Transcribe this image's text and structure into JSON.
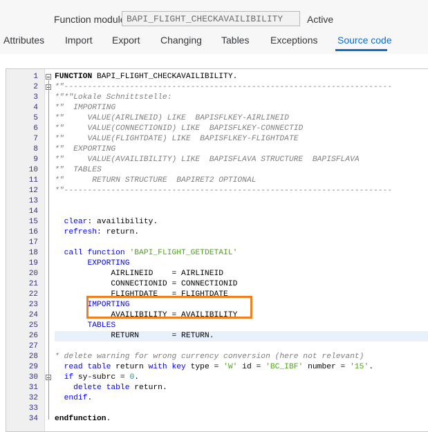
{
  "header": {
    "function_module_label": "Function module:",
    "function_module_value": "BAPI_FLIGHT_CHECKAVAILIBILITY",
    "status": "Active"
  },
  "tabs": [
    {
      "label": "Attributes",
      "active": false
    },
    {
      "label": "Import",
      "active": false
    },
    {
      "label": "Export",
      "active": false
    },
    {
      "label": "Changing",
      "active": false
    },
    {
      "label": "Tables",
      "active": false
    },
    {
      "label": "Exceptions",
      "active": false
    },
    {
      "label": "Source code",
      "active": true
    }
  ],
  "colors": {
    "accent": "#0a6ed1",
    "keyword": "#0000ff",
    "comment": "#7f7f7f",
    "string": "#4da619",
    "highlight_box": "#f07f22"
  },
  "editor": {
    "highlighted_line": 26,
    "boxed_lines": [
      23,
      24
    ],
    "lines": [
      {
        "n": "1",
        "fold": "open",
        "segs": [
          [
            "kwb",
            "FUNCTION"
          ],
          [
            "txt",
            " BAPI_FLIGHT_CHECKAVAILIBILITY."
          ]
        ]
      },
      {
        "n": "2",
        "fold": "open",
        "segs": [
          [
            "cm",
            "*\"----------------------------------------------------------------------"
          ]
        ]
      },
      {
        "n": "3",
        "fold": "",
        "segs": [
          [
            "cm",
            "*\"*\"Lokale Schnittstelle:"
          ]
        ]
      },
      {
        "n": "4",
        "fold": "",
        "segs": [
          [
            "cm",
            "*\"  IMPORTING"
          ]
        ]
      },
      {
        "n": "5",
        "fold": "",
        "segs": [
          [
            "cm",
            "*\"     VALUE(AIRLINEID) LIKE  BAPISFLKEY-AIRLINEID"
          ]
        ]
      },
      {
        "n": "6",
        "fold": "",
        "segs": [
          [
            "cm",
            "*\"     VALUE(CONNECTIONID) LIKE  BAPISFLKEY-CONNECTID"
          ]
        ]
      },
      {
        "n": "7",
        "fold": "",
        "segs": [
          [
            "cm",
            "*\"     VALUE(FLIGHTDATE) LIKE  BAPISFLKEY-FLIGHTDATE"
          ]
        ]
      },
      {
        "n": "8",
        "fold": "",
        "segs": [
          [
            "cm",
            "*\"  EXPORTING"
          ]
        ]
      },
      {
        "n": "9",
        "fold": "",
        "segs": [
          [
            "cm",
            "*\"     VALUE(AVAILIBILITY) LIKE  BAPISFLAVA STRUCTURE  BAPISFLAVA"
          ]
        ]
      },
      {
        "n": "10",
        "fold": "",
        "segs": [
          [
            "cm",
            "*\"  TABLES"
          ]
        ]
      },
      {
        "n": "11",
        "fold": "",
        "segs": [
          [
            "cm",
            "*\"      RETURN STRUCTURE  BAPIRET2 OPTIONAL"
          ]
        ]
      },
      {
        "n": "12",
        "fold": "end",
        "segs": [
          [
            "cm",
            "*\"----------------------------------------------------------------------"
          ]
        ]
      },
      {
        "n": "13",
        "fold": "",
        "segs": []
      },
      {
        "n": "14",
        "fold": "",
        "segs": []
      },
      {
        "n": "15",
        "fold": "",
        "segs": [
          [
            "txt",
            "  "
          ],
          [
            "kw",
            "clear"
          ],
          [
            "txt",
            ": availibility."
          ]
        ]
      },
      {
        "n": "16",
        "fold": "",
        "segs": [
          [
            "txt",
            "  "
          ],
          [
            "kw",
            "refresh"
          ],
          [
            "txt",
            ": return."
          ]
        ]
      },
      {
        "n": "17",
        "fold": "",
        "segs": []
      },
      {
        "n": "18",
        "fold": "",
        "segs": [
          [
            "txt",
            "  "
          ],
          [
            "kw",
            "call function"
          ],
          [
            "txt",
            " "
          ],
          [
            "str",
            "'BAPI_FLIGHT_GETDETAIL'"
          ]
        ]
      },
      {
        "n": "19",
        "fold": "",
        "segs": [
          [
            "txt",
            "       "
          ],
          [
            "kw",
            "EXPORTING"
          ]
        ]
      },
      {
        "n": "20",
        "fold": "",
        "segs": [
          [
            "txt",
            "            AIRLINEID    = AIRLINEID"
          ]
        ]
      },
      {
        "n": "21",
        "fold": "",
        "segs": [
          [
            "txt",
            "            CONNECTIONID = CONNECTIONID"
          ]
        ]
      },
      {
        "n": "22",
        "fold": "",
        "segs": [
          [
            "txt",
            "            FLIGHTDATE   = FLIGHTDATE"
          ]
        ]
      },
      {
        "n": "23",
        "fold": "",
        "segs": [
          [
            "txt",
            "       "
          ],
          [
            "kw",
            "IMPORTING"
          ]
        ]
      },
      {
        "n": "24",
        "fold": "",
        "segs": [
          [
            "txt",
            "            AVAILIBILITY = AVAILIBILITY"
          ]
        ]
      },
      {
        "n": "25",
        "fold": "",
        "segs": [
          [
            "txt",
            "       "
          ],
          [
            "kw",
            "TABLES"
          ]
        ]
      },
      {
        "n": "26",
        "fold": "",
        "segs": [
          [
            "txt",
            "            RETURN       = RETURN."
          ]
        ]
      },
      {
        "n": "27",
        "fold": "",
        "segs": []
      },
      {
        "n": "28",
        "fold": "",
        "segs": [
          [
            "cm",
            "* delete warning for wrong currency conversion (here not relevant)"
          ]
        ]
      },
      {
        "n": "29",
        "fold": "",
        "segs": [
          [
            "txt",
            "  "
          ],
          [
            "kw",
            "read table"
          ],
          [
            "txt",
            " return "
          ],
          [
            "kw",
            "with key"
          ],
          [
            "txt",
            " type = "
          ],
          [
            "str",
            "'W'"
          ],
          [
            "txt",
            " id = "
          ],
          [
            "str",
            "'BC_IBF'"
          ],
          [
            "txt",
            " number = "
          ],
          [
            "str",
            "'15'"
          ],
          [
            "txt",
            "."
          ]
        ]
      },
      {
        "n": "30",
        "fold": "open",
        "segs": [
          [
            "txt",
            "  "
          ],
          [
            "kw",
            "if"
          ],
          [
            "txt",
            " sy-subrc = "
          ],
          [
            "num",
            "0"
          ],
          [
            "txt",
            "."
          ]
        ]
      },
      {
        "n": "31",
        "fold": "",
        "segs": [
          [
            "txt",
            "    "
          ],
          [
            "kw",
            "delete table"
          ],
          [
            "txt",
            " return."
          ]
        ]
      },
      {
        "n": "32",
        "fold": "end",
        "segs": [
          [
            "txt",
            "  "
          ],
          [
            "kw",
            "endif"
          ],
          [
            "txt",
            "."
          ]
        ]
      },
      {
        "n": "33",
        "fold": "",
        "segs": []
      },
      {
        "n": "34",
        "fold": "end",
        "segs": [
          [
            "kwb",
            "endfunction"
          ],
          [
            "txt",
            "."
          ]
        ]
      }
    ]
  }
}
